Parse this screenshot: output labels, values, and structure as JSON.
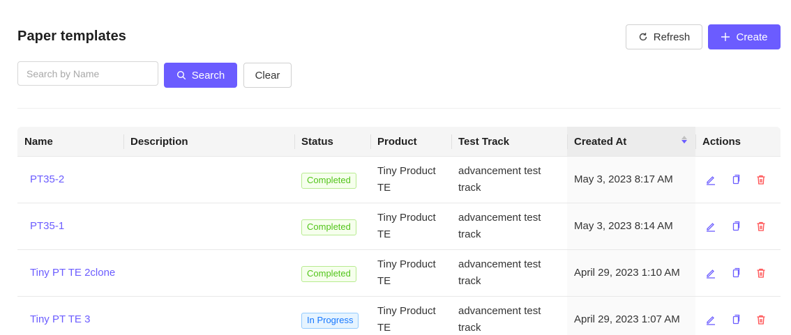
{
  "page": {
    "title": "Paper templates"
  },
  "toolbar": {
    "refresh_label": "Refresh",
    "create_label": "Create"
  },
  "search": {
    "placeholder": "Search by Name",
    "value": "",
    "search_label": "Search",
    "clear_label": "Clear"
  },
  "table": {
    "columns": [
      "Name",
      "Description",
      "Status",
      "Product",
      "Test Track",
      "Created At",
      "Actions"
    ],
    "rows": [
      {
        "name": "PT35-2",
        "description": "",
        "status": "Completed",
        "product_line1": "Tiny Product",
        "product_line2": "TE",
        "track_line1": "advancement test",
        "track_line2": "track",
        "created_at": "May 3, 2023 8:17 AM"
      },
      {
        "name": "PT35-1",
        "description": "",
        "status": "Completed",
        "product_line1": "Tiny Product",
        "product_line2": "TE",
        "track_line1": "advancement test",
        "track_line2": "track",
        "created_at": "May 3, 2023 8:14 AM"
      },
      {
        "name": "Tiny PT TE 2clone",
        "description": "",
        "status": "Completed",
        "product_line1": "Tiny Product",
        "product_line2": "TE",
        "track_line1": "advancement test",
        "track_line2": "track",
        "created_at": "April 29, 2023 1:10 AM"
      },
      {
        "name": "Tiny PT TE 3",
        "description": "",
        "status": "In Progress",
        "product_line1": "Tiny Product",
        "product_line2": "TE",
        "track_line1": "advancement test",
        "track_line2": "track",
        "created_at": "April 29, 2023 1:07 AM"
      }
    ]
  },
  "icons": {
    "refresh": "refresh-icon",
    "create": "plus-icon",
    "search": "search-icon",
    "edit": "edit-icon",
    "copy": "copy-icon",
    "delete": "delete-icon",
    "sort": "sort-icon"
  },
  "colors": {
    "primary": "#6b5cff",
    "completed": "#52c41a",
    "in_progress": "#1677ff",
    "delete": "#ff4d4f"
  }
}
